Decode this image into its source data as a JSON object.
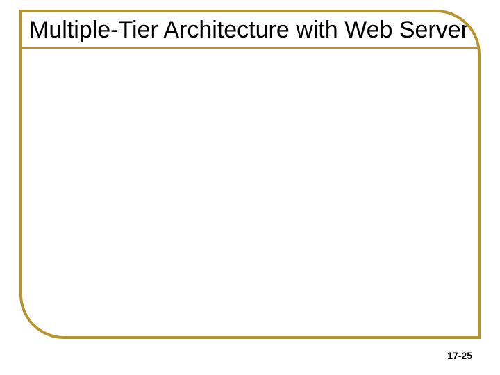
{
  "slide": {
    "title": "Multiple-Tier Architecture with Web Server",
    "page_number": "17-25"
  },
  "theme": {
    "accent": "#b6942f"
  }
}
